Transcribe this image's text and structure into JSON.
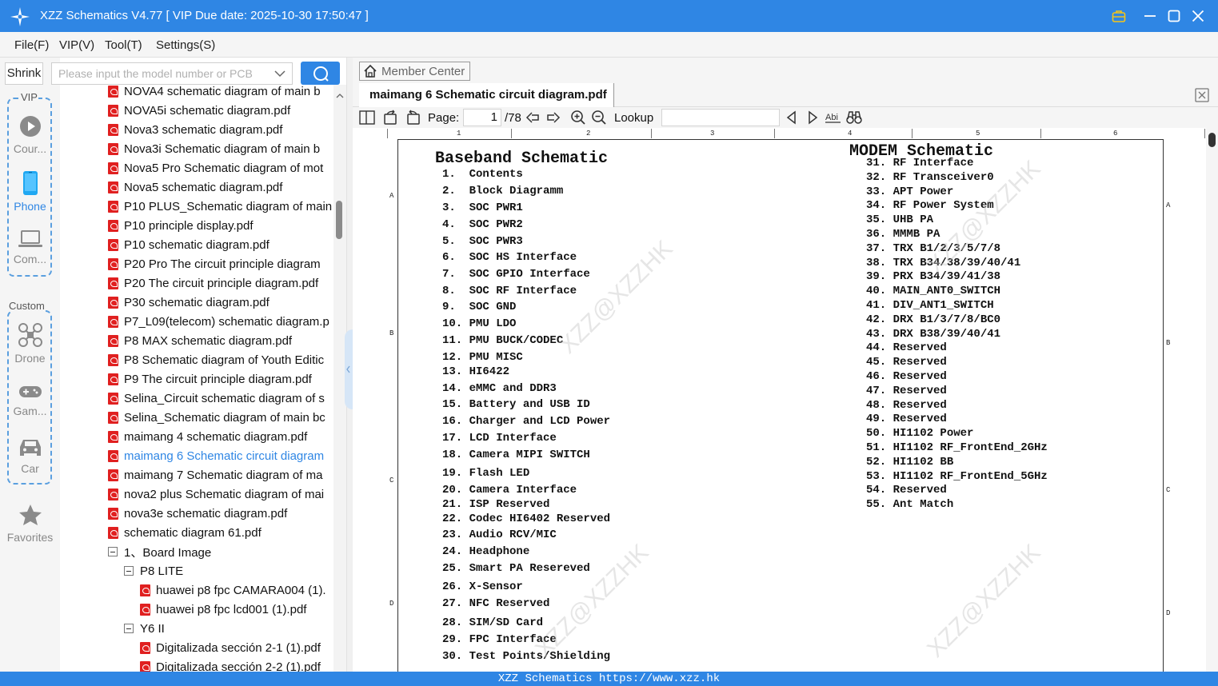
{
  "window": {
    "title": "XZZ Schematics V4.77 [ VIP Due date: 2025-10-30 17:50:47 ]"
  },
  "menu": [
    "File(F)",
    "VIP(V)",
    "Tool(T)",
    "Settings(S)"
  ],
  "search": {
    "shrink_label": "Shrink",
    "placeholder": "Please input the model number or PCB"
  },
  "sidebar": {
    "vip_label": "VIP",
    "custom_label": "Custom",
    "items": [
      {
        "label": "Cour...",
        "icon": "play-circle-icon"
      },
      {
        "label": "Phone",
        "icon": "phone-icon",
        "active": true
      },
      {
        "label": "Com...",
        "icon": "laptop-icon"
      },
      {
        "label": "Drone",
        "icon": "drone-icon"
      },
      {
        "label": "Gam...",
        "icon": "gamepad-icon"
      },
      {
        "label": "Car",
        "icon": "car-icon"
      },
      {
        "label": "Favorites",
        "icon": "star-icon"
      }
    ]
  },
  "tree": {
    "items": [
      {
        "label": "NOVA4 schematic diagram of main b",
        "type": "pdf",
        "indent": 0
      },
      {
        "label": "NOVA5i schematic diagram.pdf",
        "type": "pdf",
        "indent": 0
      },
      {
        "label": "Nova3 schematic diagram.pdf",
        "type": "pdf",
        "indent": 0
      },
      {
        "label": "Nova3i Schematic diagram of main b",
        "type": "pdf",
        "indent": 0
      },
      {
        "label": "Nova5 Pro Schematic diagram of mot",
        "type": "pdf",
        "indent": 0
      },
      {
        "label": "Nova5 schematic diagram.pdf",
        "type": "pdf",
        "indent": 0
      },
      {
        "label": "P10 PLUS_Schematic diagram of main",
        "type": "pdf",
        "indent": 0
      },
      {
        "label": "P10 principle display.pdf",
        "type": "pdf",
        "indent": 0
      },
      {
        "label": "P10 schematic diagram.pdf",
        "type": "pdf",
        "indent": 0
      },
      {
        "label": "P20 Pro The circuit principle diagram",
        "type": "pdf",
        "indent": 0
      },
      {
        "label": "P20 The circuit principle diagram.pdf",
        "type": "pdf",
        "indent": 0
      },
      {
        "label": "P30 schematic diagram.pdf",
        "type": "pdf",
        "indent": 0
      },
      {
        "label": "P7_L09(telecom) schematic diagram.p",
        "type": "pdf",
        "indent": 0
      },
      {
        "label": "P8 MAX schematic diagram.pdf",
        "type": "pdf",
        "indent": 0
      },
      {
        "label": "P8 Schematic diagram of Youth Editic",
        "type": "pdf",
        "indent": 0
      },
      {
        "label": "P9 The circuit principle diagram.pdf",
        "type": "pdf",
        "indent": 0
      },
      {
        "label": "Selina_Circuit schematic diagram of s",
        "type": "pdf",
        "indent": 0
      },
      {
        "label": "Selina_Schematic diagram of main bc",
        "type": "pdf",
        "indent": 0
      },
      {
        "label": "maimang 4 schematic diagram.pdf",
        "type": "pdf",
        "indent": 0
      },
      {
        "label": "maimang 6 Schematic circuit diagram",
        "type": "pdf",
        "indent": 0,
        "selected": true
      },
      {
        "label": "maimang 7 Schematic diagram of ma",
        "type": "pdf",
        "indent": 0
      },
      {
        "label": "nova2 plus Schematic diagram of mai",
        "type": "pdf",
        "indent": 0
      },
      {
        "label": "nova3e schematic diagram.pdf",
        "type": "pdf",
        "indent": 0
      },
      {
        "label": "schematic diagram 61.pdf",
        "type": "pdf",
        "indent": 0
      },
      {
        "label": "1、Board Image",
        "type": "folder",
        "indent": 0
      },
      {
        "label": "P8 LITE",
        "type": "folder",
        "indent": 1
      },
      {
        "label": "huawei p8 fpc CAMARA004 (1).",
        "type": "pdf",
        "indent": 2
      },
      {
        "label": "huawei p8 fpc lcd001 (1).pdf",
        "type": "pdf",
        "indent": 2
      },
      {
        "label": "Y6 II",
        "type": "folder",
        "indent": 1
      },
      {
        "label": "Digitalizada sección 2-1 (1).pdf",
        "type": "pdf",
        "indent": 2
      },
      {
        "label": "Digitalizada sección 2-2 (1).pdf",
        "type": "pdf",
        "indent": 2
      }
    ]
  },
  "viewer": {
    "member_center": "Member Center",
    "tab_title": "maimang 6 Schematic circuit diagram.pdf",
    "page_label": "Page:",
    "page_value": "1",
    "page_total": "/78",
    "lookup_label": "Lookup"
  },
  "ruler": {
    "top": [
      "1",
      "2",
      "3",
      "4",
      "5",
      "6"
    ],
    "side": [
      "A",
      "B",
      "C",
      "D"
    ]
  },
  "schematic": {
    "left_title": "Baseband Schematic",
    "left_items": [
      "1.  Contents",
      "2.  Block Diagramm",
      "3.  SOC PWR1",
      "4.  SOC PWR2",
      "5.  SOC PWR3",
      "6.  SOC HS Interface",
      "7.  SOC GPIO Interface",
      "8.  SOC RF Interface",
      "9.  SOC GND",
      "10. PMU LDO",
      "11. PMU BUCK/CODEC",
      "12. PMU MISC",
      "13. HI6422",
      "14. eMMC and DDR3",
      "15. Battery and USB ID",
      "16. Charger and LCD Power",
      "17. LCD Interface",
      "18. Camera MIPI SWITCH",
      "19. Flash LED",
      "20. Camera Interface",
      "21. ISP Reserved",
      "22. Codec HI6402 Reserved",
      "23. Audio RCV/MIC",
      "24. Headphone",
      "25. Smart PA Resereved",
      "26. X-Sensor",
      "27. NFC Reserved",
      "28. SIM/SD Card",
      "29. FPC Interface",
      "30. Test Points/Shielding"
    ],
    "right_title": "MODEM Schematic",
    "right_items": [
      "31. RF Interface",
      "32. RF Transceiver0",
      "33. APT Power",
      "34. RF Power System",
      "35. UHB PA",
      "36. MMMB PA",
      "37. TRX B1/2/3/5/7/8",
      "38. TRX B34/38/39/40/41",
      "39. PRX B34/39/41/38",
      "40. MAIN_ANT0_SWITCH",
      "41. DIV_ANT1_SWITCH",
      "42. DRX B1/3/7/8/BC0",
      "43. DRX B38/39/40/41",
      "44. Reserved",
      "45. Reserved",
      "46. Reserved",
      "47. Reserved",
      "48. Reserved",
      "49. Reserved",
      "50. HI1102 Power",
      "51. HI1102 RF_FrontEnd_2GHz",
      "52. HI1102 BB",
      "53. HI1102 RF_FrontEnd_5GHz",
      "54. Reserved",
      "55. Ant Match"
    ],
    "watermark": "XZZ@XZZHK"
  },
  "statusbar": "XZZ Schematics https://www.xzz.hk",
  "colors": {
    "accent": "#2f86e4",
    "pdf_icon": "#e02020"
  }
}
